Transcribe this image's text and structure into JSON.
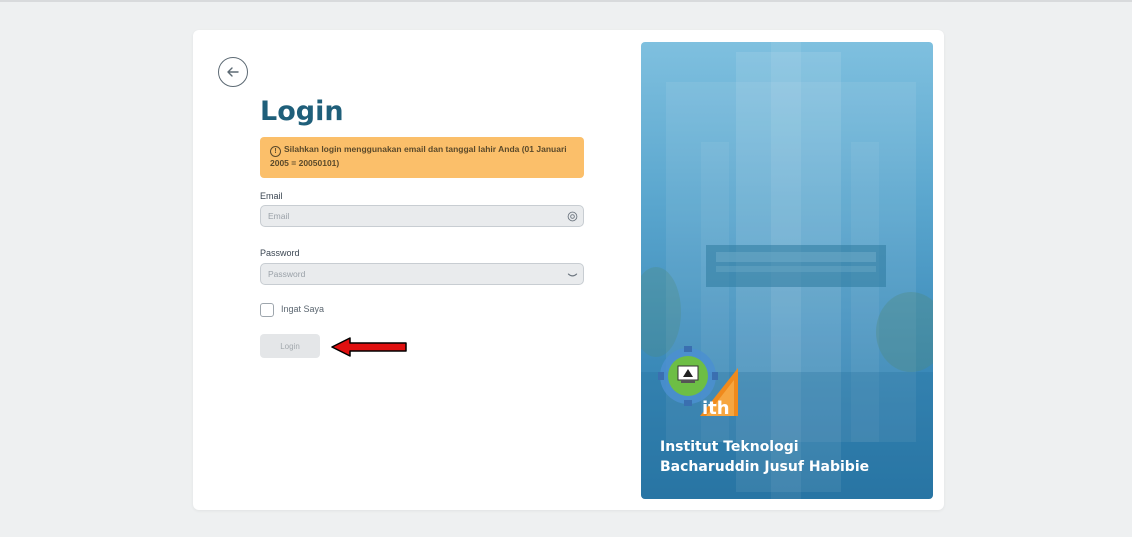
{
  "page": {
    "title": "Login"
  },
  "alert": {
    "icon": "info-circle-icon",
    "text": "Silahkan login menggunakan email dan tanggal lahir Anda (01 Januari 2005 = 20050101)"
  },
  "form": {
    "email": {
      "label": "Email",
      "placeholder": "Email",
      "value": "",
      "icon": "at-sign-icon"
    },
    "password": {
      "label": "Password",
      "placeholder": "Password",
      "value": "",
      "icon": "eye-closed-icon"
    },
    "remember": {
      "label": "Ingat Saya",
      "checked": false
    },
    "submit_label": "Login"
  },
  "panel": {
    "institution_line1": "Institut Teknologi",
    "institution_line2": "Bacharuddin Jusuf Habibie",
    "logo_text": "ith"
  },
  "colors": {
    "title": "#1f5f7a",
    "alert_bg": "#fbbf6a",
    "panel_top": "#7fc0df",
    "panel_bottom": "#2b78a8",
    "arrow": "#e01010"
  }
}
